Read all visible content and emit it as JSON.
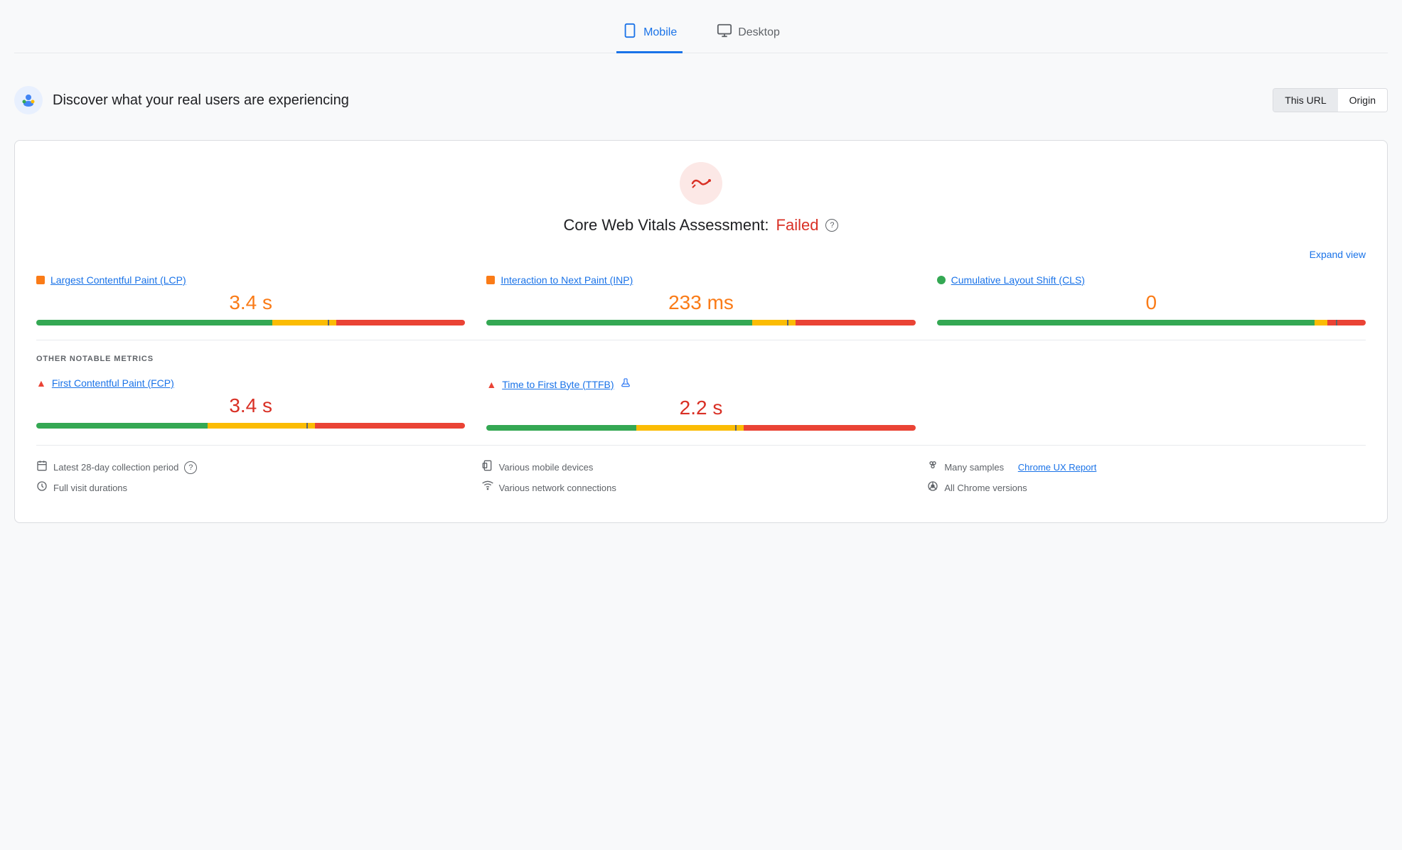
{
  "tabs": [
    {
      "id": "mobile",
      "label": "Mobile",
      "icon": "📱",
      "active": true
    },
    {
      "id": "desktop",
      "label": "Desktop",
      "icon": "🖥",
      "active": false
    }
  ],
  "section": {
    "title": "Discover what your real users are experiencing",
    "url_toggle": {
      "this_url_label": "This URL",
      "origin_label": "Origin",
      "active": "this_url"
    }
  },
  "core_vitals": {
    "assessment_label": "Core Web Vitals Assessment:",
    "status": "Failed",
    "expand_label": "Expand view",
    "metrics": [
      {
        "id": "lcp",
        "label": "Largest Contentful Paint (LCP)",
        "dot_color": "orange",
        "value": "3.4 s",
        "value_color": "orange",
        "bar": {
          "green": 55,
          "orange": 15,
          "red": 30,
          "marker": 68
        }
      },
      {
        "id": "inp",
        "label": "Interaction to Next Paint (INP)",
        "dot_color": "orange",
        "value": "233 ms",
        "value_color": "orange",
        "bar": {
          "green": 62,
          "orange": 10,
          "red": 28,
          "marker": 70
        }
      },
      {
        "id": "cls",
        "label": "Cumulative Layout Shift (CLS)",
        "dot_color": "green",
        "value": "0",
        "value_color": "orange",
        "bar": {
          "green": 88,
          "orange": 3,
          "red": 9,
          "marker": 93
        }
      }
    ]
  },
  "other_metrics": {
    "section_label": "OTHER NOTABLE METRICS",
    "metrics": [
      {
        "id": "fcp",
        "label": "First Contentful Paint (FCP)",
        "icon": "triangle",
        "value": "3.4 s",
        "value_color": "red",
        "bar": {
          "green": 40,
          "orange": 25,
          "red": 35,
          "marker": 63
        }
      },
      {
        "id": "ttfb",
        "label": "Time to First Byte (TTFB)",
        "icon": "triangle",
        "extra_icon": "flask",
        "value": "2.2 s",
        "value_color": "red",
        "bar": {
          "green": 35,
          "orange": 25,
          "red": 40,
          "marker": 58
        }
      }
    ]
  },
  "footer": {
    "col1": [
      {
        "icon": "📅",
        "text": "Latest 28-day collection period",
        "has_help": true
      },
      {
        "icon": "⏱",
        "text": "Full visit durations",
        "has_help": false
      }
    ],
    "col2": [
      {
        "icon": "📺",
        "text": "Various mobile devices",
        "has_help": false
      },
      {
        "icon": "📶",
        "text": "Various network connections",
        "has_help": false
      }
    ],
    "col3": [
      {
        "icon": "⚙",
        "text": "Many samples",
        "link_text": "Chrome UX Report",
        "has_help": false
      },
      {
        "icon": "🛡",
        "text": "All Chrome versions",
        "has_help": false
      }
    ]
  }
}
